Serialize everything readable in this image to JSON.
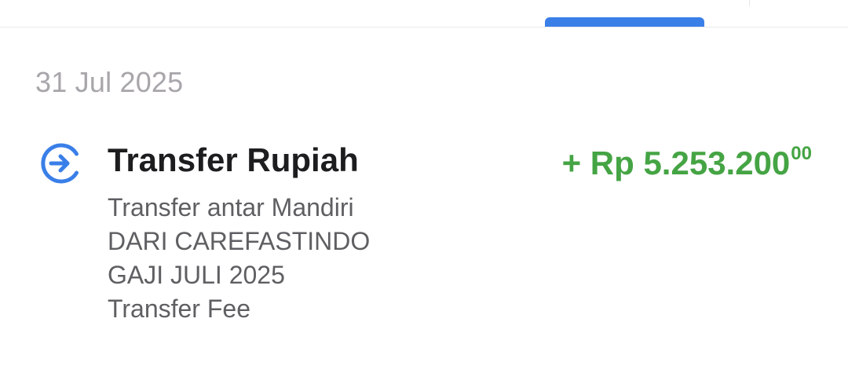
{
  "date_header": "31 Jul 2025",
  "transaction": {
    "icon": "transfer-in-icon",
    "title": "Transfer Rupiah",
    "description_lines": [
      "Transfer antar Mandiri",
      "DARI CAREFASTINDO",
      "GAJI JULI 2025",
      "Transfer Fee"
    ],
    "amount_prefix": "+ Rp 5.253.200",
    "amount_cents": "00"
  },
  "colors": {
    "accent_blue": "#3a7fe8",
    "amount_green": "#45a444",
    "date_grey": "#a9a6ab",
    "title": "#1d1d1f",
    "description": "#5f5f63"
  }
}
